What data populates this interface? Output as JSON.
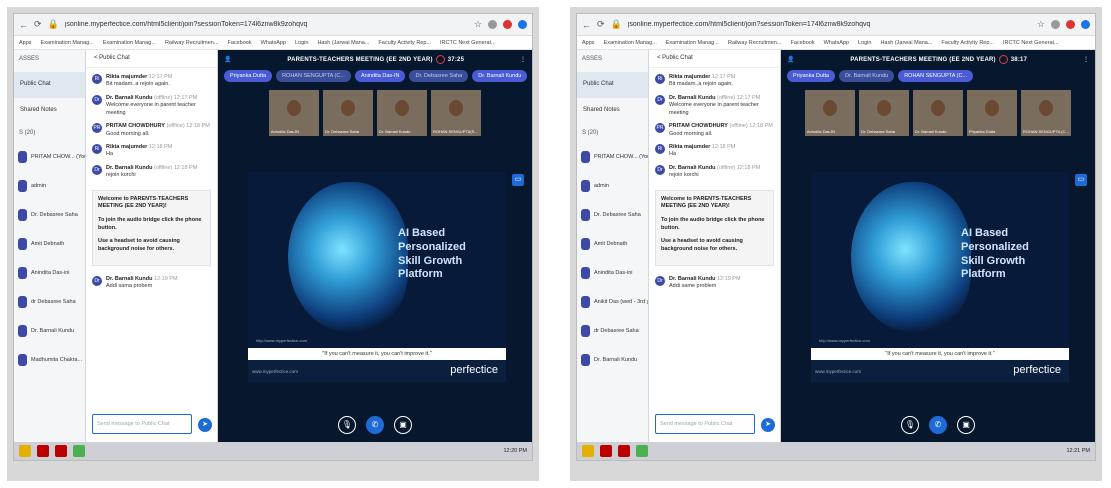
{
  "panels": [
    {
      "browser": {
        "url": "jsonline.myperfectice.com/html5client/join?sessionToken=174l6znw8k9zohqvq"
      },
      "bookmarks": [
        "Apps",
        "Examination Manag...",
        "Examination Manag...",
        "Railway Recruitmen...",
        "Facebook",
        "WhatsApp",
        "Login",
        "Hash (Jarwai Mana...",
        "Faculty Activity Rep...",
        "IRCTC Next Generat..."
      ],
      "sidebar": {
        "header": "ASSES",
        "public_chat": "Public Chat",
        "shared_notes": "Shared Notes",
        "users_header": "S (20)",
        "users": [
          "PRITAM CHOW... (You)",
          "admin",
          "Dr. Debasree Saha",
          "Amit Debnath",
          "Anindita Das-ini",
          "dr Debasree Saha",
          "Dr. Barnali Kundu",
          "Madhumita Chakra..."
        ]
      },
      "chat": {
        "title": "< Public Chat",
        "messages": [
          {
            "initials": "Ri",
            "name": "Rikta majumder",
            "time": "12:17 PM",
            "text": "Bit madam..a rejoin again."
          },
          {
            "initials": "Dr",
            "name": "Dr. Barnali Kundu",
            "time": "(offline) 12:17 PM",
            "text": "Welcome everyone in parent teacher meeting"
          },
          {
            "initials": "PR",
            "name": "PRITAM CHOWDHURY",
            "time": "(offline) 12:18 PM",
            "text": "Good morning all."
          },
          {
            "initials": "Ri",
            "name": "Rikta majumder",
            "time": "12:18 PM",
            "text": "Ha"
          },
          {
            "initials": "Dr",
            "name": "Dr. Barnali Kundu",
            "time": "(offline) 12:18 PM",
            "text": "rejoin korchi"
          }
        ],
        "welcome": [
          "Welcome to PARENTS-TEACHERS MEETING (EE 2ND YEAR)!",
          "To join the audio bridge click the phone button.",
          "Use a headset to avoid causing background noise for others."
        ],
        "last": {
          "initials": "Dr",
          "name": "Dr. Barnali Kundu",
          "time": "12:19 PM",
          "text": "Addi sama probem"
        },
        "placeholder": "Send message to Public Chat"
      },
      "meeting": {
        "title": "PARENTS-TEACHERS MEETING (EE 2ND YEAR)",
        "timer": "37:25",
        "presenters": [
          "Priyanka Dutta",
          "ROHAN SENGUPTA (C...",
          "Anindita Das-IN",
          "Dr. Debasree Saha",
          "Dr. Barnali Kundu"
        ],
        "tiles": [
          "Anindita Das-IN",
          "Dr. Debasree Saha",
          "Dr. Barnali Kundu",
          "ROHAN SENGUPTA(S..."
        ],
        "slide_lines": [
          "AI Based",
          "Personalized",
          "Skill Growth Platform"
        ],
        "slide_tag": "http://www.myperfectice.com",
        "quote": "\"If you can't measure it, you can't improve it.\"",
        "site": "www.myperfectice.com",
        "logo": "perfectice"
      },
      "taskbar": {
        "clock": "12:20 PM"
      }
    },
    {
      "browser": {
        "url": "jsonline.myperfectice.com/html5client/join?sessionToken=174l6znw8k9zohqvq"
      },
      "bookmarks": [
        "Apps",
        "Examination Manag...",
        "Examination Manag...",
        "Railway Recruitmen...",
        "Facebook",
        "WhatsApp",
        "Login",
        "Hash (Jarwai Mana...",
        "Faculty Activity Rep...",
        "IRCTC Next Generat..."
      ],
      "sidebar": {
        "header": "ASSES",
        "public_chat": "Public Chat",
        "shared_notes": "Shared Notes",
        "users_header": "S (20)",
        "users": [
          "PRITAM CHOW... (You)",
          "admin",
          "Dr. Debasree Saha",
          "Amit Debnath",
          "Anindita Das-ini",
          "Anikit Das (wed - 3rd y...",
          "dr Debasree Saha",
          "Dr. Barnali Kundu"
        ]
      },
      "chat": {
        "title": "< Public Chat",
        "messages": [
          {
            "initials": "Ri",
            "name": "Rikta majumder",
            "time": "12:17 PM",
            "text": "Bit madam..a rejoin again."
          },
          {
            "initials": "Dr",
            "name": "Dr. Barnali Kundu",
            "time": "(offline) 12:17 PM",
            "text": "Welcome everyone in parent teacher meeting"
          },
          {
            "initials": "PR",
            "name": "PRITAM CHOWDHURY",
            "time": "(offline) 12:18 PM",
            "text": "Good morning all."
          },
          {
            "initials": "Ri",
            "name": "Rikta majumder",
            "time": "12:18 PM",
            "text": "Ha"
          },
          {
            "initials": "Dr",
            "name": "Dr. Barnali Kundu",
            "time": "(offline) 12:18 PM",
            "text": "rejoin korchi"
          }
        ],
        "welcome": [
          "Welcome to PARENTS-TEACHERS MEETING (EE 2ND YEAR)!",
          "To join the audio bridge click the phone button.",
          "Use a headset to avoid causing background noise for others."
        ],
        "last": {
          "initials": "Dr",
          "name": "Dr. Barnali Kundu",
          "time": "12:19 PM",
          "text": "Addi same problem"
        },
        "placeholder": "Send message to Public Chat"
      },
      "meeting": {
        "title": "PARENTS-TEACHERS MEETING (EE 2ND YEAR)",
        "timer": "38:17",
        "presenters": [
          "Priyanka Dutta",
          "Dr. Barnali Kundu",
          "ROHAN SENGUPTA (C..."
        ],
        "tiles": [
          "Anindita Das-IN",
          "Dr. Debasree Saha",
          "Dr. Barnali Kundu",
          "Priyanka Dutta",
          "ROHAN SENGUPTA (C..."
        ],
        "slide_lines": [
          "AI Based",
          "Personalized",
          "Skill Growth Platform"
        ],
        "slide_tag": "http://www.myperfectice.com",
        "quote": "\"If you can't measure it, you can't improve it.\"",
        "site": "www.myperfectice.com",
        "logo": "perfectice"
      },
      "taskbar": {
        "clock": "12:21 PM"
      }
    }
  ]
}
